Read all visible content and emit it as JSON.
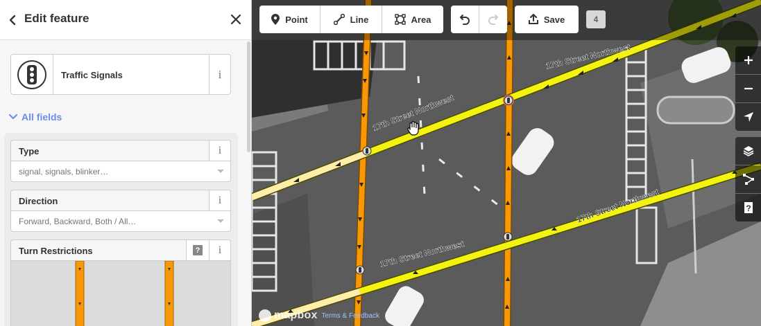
{
  "sidebar": {
    "title": "Edit feature",
    "preset": {
      "name": "Traffic Signals",
      "info": "i"
    },
    "all_fields_label": "All fields",
    "fields": [
      {
        "label": "Type",
        "placeholder": "signal, signals, blinker…",
        "info": "i"
      },
      {
        "label": "Direction",
        "placeholder": "Forward, Backward, Both / All…",
        "info": "i"
      },
      {
        "label": "Turn Restrictions",
        "help": "?",
        "info": "i"
      }
    ]
  },
  "toolbar": {
    "point_label": "Point",
    "line_label": "Line",
    "area_label": "Area",
    "save_label": "Save",
    "edit_count": "4"
  },
  "map": {
    "street_labels": [
      "17th Street Northwest",
      "17th Street Northwest",
      "17th Street Northwest",
      "17th Street Northwest"
    ],
    "zoom_in": "+",
    "zoom_out": "−",
    "help": "?",
    "attribution": {
      "logo": "mapbox",
      "terms": "Terms & Feedback"
    }
  },
  "colors": {
    "accent": "#6d8de8",
    "street_yellow": "#f3f312",
    "street_orange": "#f99806",
    "street_pale": "#ffeeaa"
  }
}
